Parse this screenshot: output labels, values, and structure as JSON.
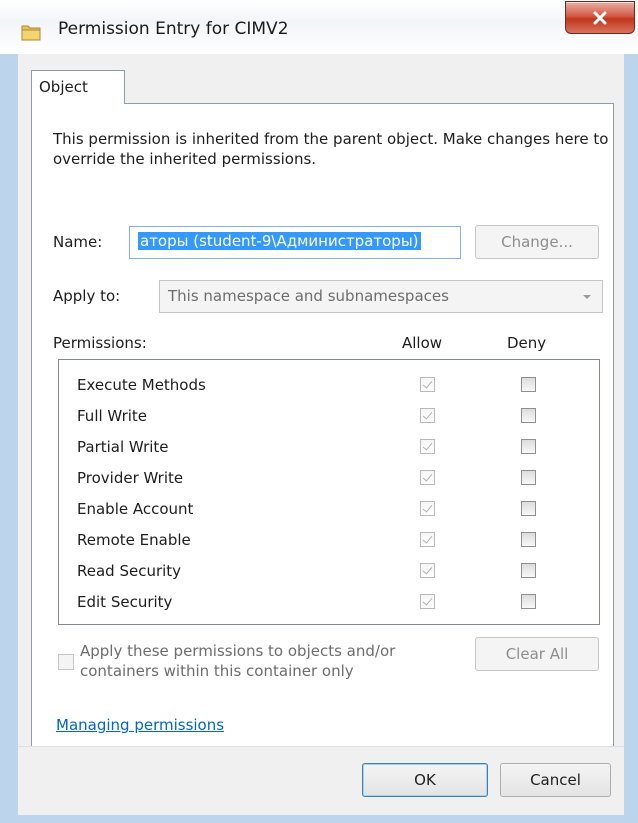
{
  "window": {
    "title": "Permission Entry for CIMV2",
    "close_label": "x"
  },
  "tabs": [
    {
      "label": "Object"
    }
  ],
  "description": "This permission is inherited from the parent object. Make changes here to override the inherited permissions.",
  "name_field": {
    "label": "Name:",
    "value": "аторы (student-9\\Администраторы)",
    "change_button": "Change..."
  },
  "apply_to": {
    "label": "Apply to:",
    "value": "This namespace and subnamespaces"
  },
  "permissions": {
    "label": "Permissions:",
    "allow_header": "Allow",
    "deny_header": "Deny",
    "rows": [
      {
        "name": "Execute Methods",
        "allow": true,
        "deny": false
      },
      {
        "name": "Full Write",
        "allow": true,
        "deny": false
      },
      {
        "name": "Partial Write",
        "allow": true,
        "deny": false
      },
      {
        "name": "Provider Write",
        "allow": true,
        "deny": false
      },
      {
        "name": "Enable Account",
        "allow": true,
        "deny": false
      },
      {
        "name": "Remote Enable",
        "allow": true,
        "deny": false
      },
      {
        "name": "Read Security",
        "allow": true,
        "deny": false
      },
      {
        "name": "Edit Security",
        "allow": true,
        "deny": false
      }
    ]
  },
  "apply_container": {
    "label": "Apply these permissions to objects and/or containers within this container only",
    "checked": false
  },
  "clear_all_button": "Clear All",
  "link": "Managing permissions",
  "ok_button": "OK",
  "cancel_button": "Cancel",
  "colors": {
    "titlebar_frame": "#bcd4ec",
    "close_button": "#c2361e",
    "selection": "#3399ff",
    "link": "#0066cc"
  }
}
